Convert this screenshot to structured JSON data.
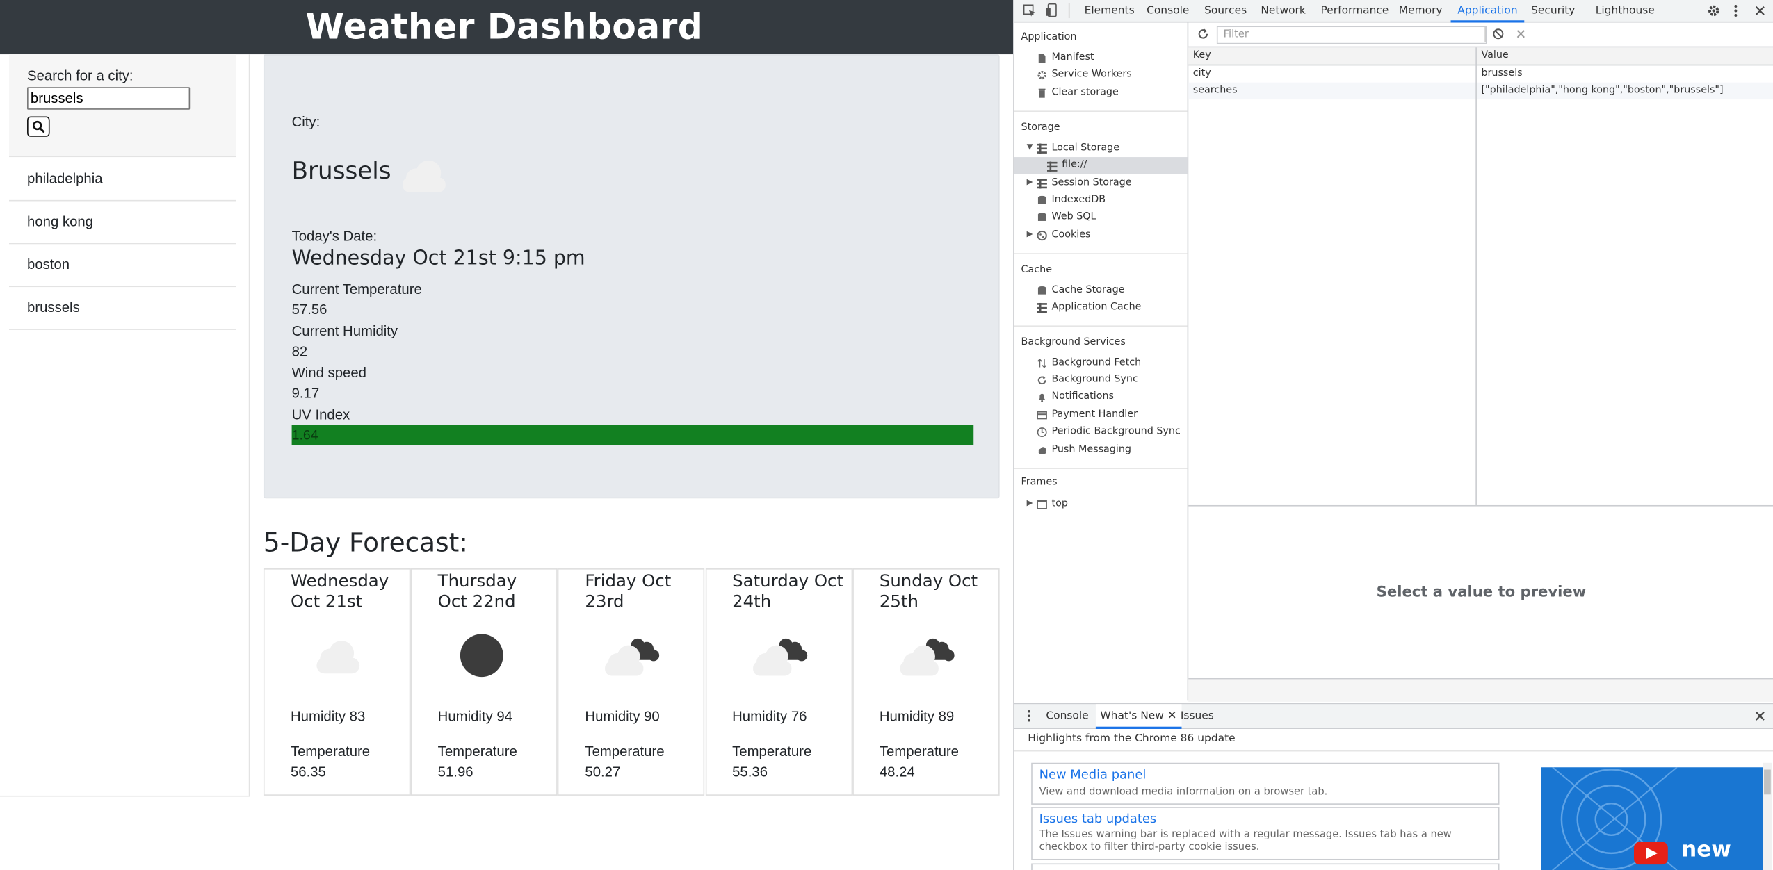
{
  "app": {
    "title": "Weather Dashboard",
    "search": {
      "label": "Search for a city:",
      "value": "brussels"
    },
    "history": [
      "philadelphia",
      "hong kong",
      "boston",
      "brussels"
    ],
    "current": {
      "city_label": "City:",
      "city": "Brussels",
      "icon": "cloud-icon",
      "date_label": "Today's Date:",
      "date": "Wednesday Oct 21st 9:15 pm",
      "temp_label": "Current Temperature",
      "temp": "57.56",
      "humidity_label": "Current Humidity",
      "humidity": "82",
      "wind_label": "Wind speed",
      "wind": "9.17",
      "uv_label": "UV Index",
      "uv": "1.64",
      "uv_color": "#128021"
    },
    "forecast_title": "5-Day Forecast:",
    "forecast": [
      {
        "date": "Wednesday Oct 21st",
        "icon": "cloud-icon",
        "humidity": "Humidity 83",
        "temp_label": "Temperature",
        "temp": "56.35"
      },
      {
        "date": "Thursday Oct 22nd",
        "icon": "moon-icon",
        "humidity": "Humidity 94",
        "temp_label": "Temperature",
        "temp": "51.96"
      },
      {
        "date": "Friday Oct 23rd",
        "icon": "broken-clouds-icon",
        "humidity": "Humidity 90",
        "temp_label": "Temperature",
        "temp": "50.27"
      },
      {
        "date": "Saturday Oct 24th",
        "icon": "broken-clouds-icon",
        "humidity": "Humidity 76",
        "temp_label": "Temperature",
        "temp": "55.36"
      },
      {
        "date": "Sunday Oct 25th",
        "icon": "broken-clouds-icon",
        "humidity": "Humidity 89",
        "temp_label": "Temperature",
        "temp": "48.24"
      }
    ]
  },
  "devtools": {
    "tabs": [
      "Elements",
      "Console",
      "Sources",
      "Network",
      "Performance",
      "Memory",
      "Application",
      "Security",
      "Lighthouse"
    ],
    "active_tab": "Application",
    "sidebar": {
      "application": {
        "title": "Application",
        "items": [
          "Manifest",
          "Service Workers",
          "Clear storage"
        ]
      },
      "storage": {
        "title": "Storage",
        "items": [
          "Local Storage",
          "file://",
          "Session Storage",
          "IndexedDB",
          "Web SQL",
          "Cookies"
        ]
      },
      "cache": {
        "title": "Cache",
        "items": [
          "Cache Storage",
          "Application Cache"
        ]
      },
      "background": {
        "title": "Background Services",
        "items": [
          "Background Fetch",
          "Background Sync",
          "Notifications",
          "Payment Handler",
          "Periodic Background Sync",
          "Push Messaging"
        ]
      },
      "frames": {
        "title": "Frames",
        "items": [
          "top"
        ]
      }
    },
    "filter_placeholder": "Filter",
    "table": {
      "headers": [
        "Key",
        "Value"
      ],
      "rows": [
        {
          "key": "city",
          "value": "brussels"
        },
        {
          "key": "searches",
          "value": "[\"philadelphia\",\"hong kong\",\"boston\",\"brussels\"]"
        }
      ]
    },
    "preview": "Select a value to preview",
    "drawer": {
      "tabs": [
        "Console",
        "What's New",
        "Issues"
      ],
      "active": "What's New",
      "highlights": "Highlights from the Chrome 86 update",
      "news": [
        {
          "title": "New Media panel",
          "desc": "View and download media information on a browser tab."
        },
        {
          "title": "Issues tab updates",
          "desc": "The Issues warning bar is replaced with a regular message. Issues tab has a new checkbox to filter third-party cookie issues."
        }
      ],
      "video_label": "new"
    }
  }
}
